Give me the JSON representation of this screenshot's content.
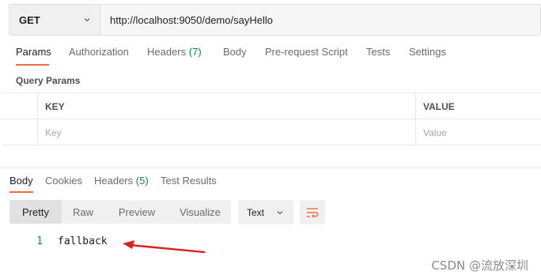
{
  "request": {
    "method": "GET",
    "url": "http://localhost:9050/demo/sayHello"
  },
  "request_tabs": [
    {
      "label": "Params"
    },
    {
      "label": "Authorization"
    },
    {
      "label": "Headers",
      "count": "(7)"
    },
    {
      "label": "Body"
    },
    {
      "label": "Pre-request Script"
    },
    {
      "label": "Tests"
    },
    {
      "label": "Settings"
    }
  ],
  "query_params": {
    "title": "Query Params",
    "columns": [
      "KEY",
      "VALUE"
    ],
    "placeholder_key": "Key",
    "placeholder_value": "Value"
  },
  "response_tabs": [
    {
      "label": "Body"
    },
    {
      "label": "Cookies"
    },
    {
      "label": "Headers",
      "count": "(5)"
    },
    {
      "label": "Test Results"
    }
  ],
  "response_view": {
    "modes": [
      "Pretty",
      "Raw",
      "Preview",
      "Visualize"
    ],
    "active_mode": "Pretty",
    "format": "Text"
  },
  "response_body": {
    "line_number": "1",
    "content": "fallback"
  },
  "annotation": {
    "color": "#e02020"
  },
  "watermark": "CSDN @流放深圳",
  "colors": {
    "accent": "#f26b3a",
    "count": "#0f8a3e",
    "line_number": "#2c6bb8"
  }
}
